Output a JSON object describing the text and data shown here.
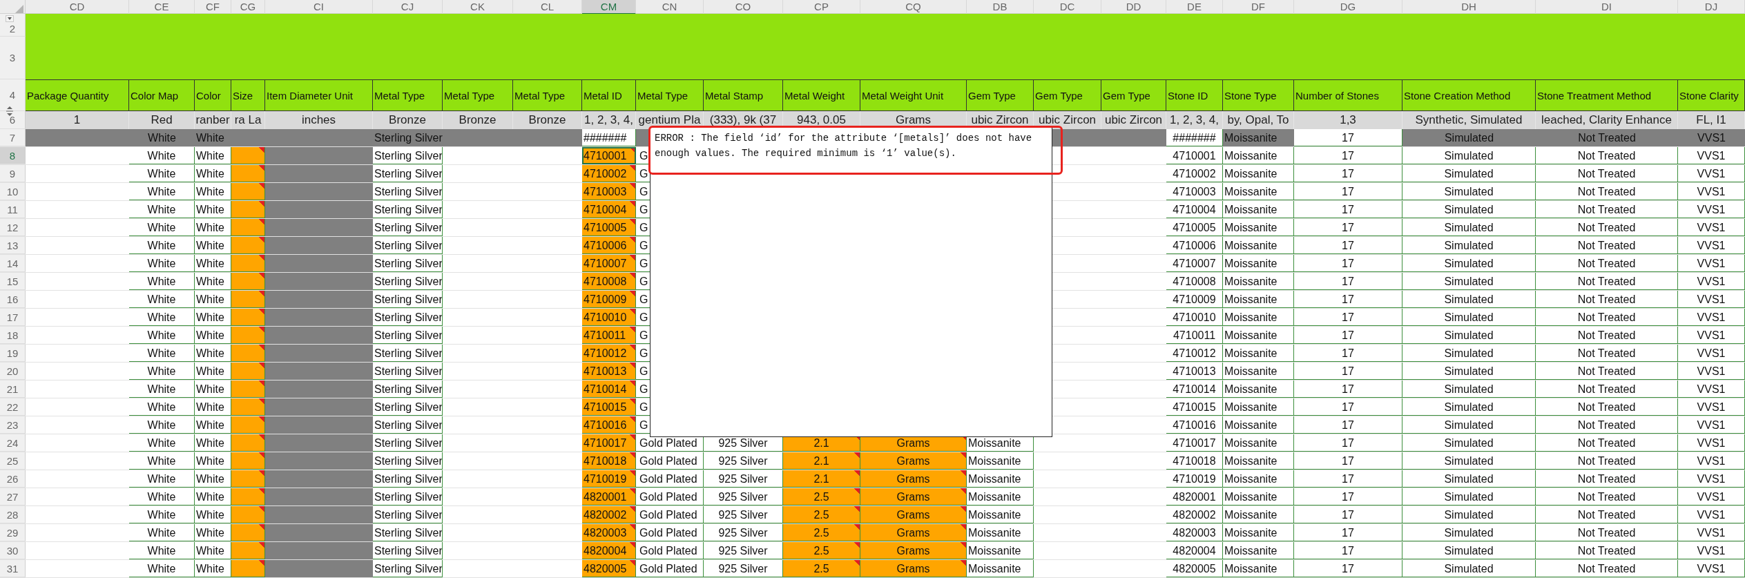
{
  "sheet": {
    "columns": [
      {
        "letter": "CD",
        "header": "Package Quantity",
        "example": "1",
        "kind": "plain",
        "selected": false
      },
      {
        "letter": "CE",
        "header": "Color Map",
        "example": "Red",
        "kind": "bordered",
        "selected": false
      },
      {
        "letter": "CF",
        "header": "Color",
        "example": "ranber",
        "kind": "bordered",
        "selected": false
      },
      {
        "letter": "CG",
        "header": "Size",
        "example": "ra La",
        "kind": "bordered",
        "selected": false
      },
      {
        "letter": "CI",
        "header": "Item Diameter Unit",
        "example": "inches",
        "kind": "plain",
        "selected": false
      },
      {
        "letter": "CJ",
        "header": "Metal Type",
        "example": "Bronze",
        "kind": "bordered",
        "selected": false
      },
      {
        "letter": "CK",
        "header": "Metal Type",
        "example": "Bronze",
        "kind": "plain",
        "selected": false
      },
      {
        "letter": "CL",
        "header": "Metal Type",
        "example": "Bronze",
        "kind": "plain",
        "selected": false
      },
      {
        "letter": "CM",
        "header": "Metal ID",
        "example": "1, 2, 3, 4,",
        "kind": "bordered",
        "selected": true
      },
      {
        "letter": "CN",
        "header": "Metal Type",
        "example": "gentium Pla",
        "kind": "bordered",
        "selected": false
      },
      {
        "letter": "CO",
        "header": "Metal Stamp",
        "example": "(333), 9k (37",
        "kind": "bordered",
        "selected": false
      },
      {
        "letter": "CP",
        "header": "Metal Weight",
        "example": "943, 0.05",
        "kind": "bordered",
        "selected": false
      },
      {
        "letter": "CQ",
        "header": "Metal Weight Unit",
        "example": "Grams",
        "kind": "bordered",
        "selected": false
      },
      {
        "letter": "DB",
        "header": "Gem Type",
        "example": "ubic Zircon",
        "kind": "bordered",
        "selected": false
      },
      {
        "letter": "DC",
        "header": "Gem Type",
        "example": "ubic Zircon",
        "kind": "plain",
        "selected": false
      },
      {
        "letter": "DD",
        "header": "Gem Type",
        "example": "ubic Zircon",
        "kind": "plain",
        "selected": false
      },
      {
        "letter": "DE",
        "header": "Stone ID",
        "example": "1, 2, 3, 4,",
        "kind": "bordered",
        "selected": false
      },
      {
        "letter": "DF",
        "header": "Stone Type",
        "example": "by, Opal, To",
        "kind": "bordered",
        "selected": false
      },
      {
        "letter": "DG",
        "header": "Number of Stones",
        "example": "1,3",
        "kind": "bordered",
        "selected": false
      },
      {
        "letter": "DH",
        "header": "Stone Creation Method",
        "example": "Synthetic, Simulated",
        "kind": "bordered",
        "selected": false
      },
      {
        "letter": "DI",
        "header": "Stone Treatment Method",
        "example": "leached, Clarity Enhance",
        "kind": "bordered",
        "selected": false
      },
      {
        "letter": "DJ",
        "header": "Stone Clarity",
        "example": "FL, I1",
        "kind": "bordered",
        "selected": false
      }
    ],
    "banner_rows": [
      "2",
      "3"
    ],
    "header_row_number": "4",
    "example_row_number": "6",
    "rows": [
      {
        "number": "7",
        "selected": false,
        "cells": [
          {
            "kind": "shaded"
          },
          {
            "text": "White",
            "kind": "shaded"
          },
          {
            "text": "White",
            "kind": "shaded"
          },
          {
            "kind": "shaded"
          },
          {
            "kind": "shaded"
          },
          {
            "text": "Sterling Silver",
            "kind": "shaded"
          },
          {
            "kind": "shaded"
          },
          {
            "kind": "shaded"
          },
          "#######",
          {
            "kind": "shaded"
          },
          null,
          null,
          null,
          null,
          {
            "kind": "shaded"
          },
          {
            "kind": "shaded"
          },
          "#######",
          {
            "text": "Moissanite",
            "kind": "shaded"
          },
          "17",
          {
            "text": "Simulated",
            "kind": "shaded"
          },
          {
            "text": "Not Treated",
            "kind": "shaded"
          },
          {
            "text": "VVS1",
            "kind": "shaded"
          }
        ]
      },
      {
        "number": "8",
        "selected": true,
        "cells": [
          null,
          "White",
          "White",
          {
            "kind": "flagged"
          },
          {
            "kind": "shaded"
          },
          "Sterling Silver",
          null,
          null,
          {
            "text": "4710001",
            "kind": "flagged"
          },
          "G",
          null,
          null,
          null,
          null,
          null,
          null,
          "4710001",
          "Moissanite",
          "17",
          "Simulated",
          "Not Treated",
          "VVS1"
        ]
      },
      {
        "number": "9",
        "selected": false,
        "cells": [
          null,
          "White",
          "White",
          {
            "kind": "flagged"
          },
          {
            "kind": "shaded"
          },
          "Sterling Silver",
          null,
          null,
          {
            "text": "4710002",
            "kind": "flagged"
          },
          "G",
          null,
          null,
          null,
          null,
          null,
          null,
          "4710002",
          "Moissanite",
          "17",
          "Simulated",
          "Not Treated",
          "VVS1"
        ]
      },
      {
        "number": "10",
        "selected": false,
        "cells": [
          null,
          "White",
          "White",
          {
            "kind": "flagged"
          },
          {
            "kind": "shaded"
          },
          "Sterling Silver",
          null,
          null,
          {
            "text": "4710003",
            "kind": "flagged"
          },
          "G",
          null,
          null,
          null,
          null,
          null,
          null,
          "4710003",
          "Moissanite",
          "17",
          "Simulated",
          "Not Treated",
          "VVS1"
        ]
      },
      {
        "number": "11",
        "selected": false,
        "cells": [
          null,
          "White",
          "White",
          {
            "kind": "flagged"
          },
          {
            "kind": "shaded"
          },
          "Sterling Silver",
          null,
          null,
          {
            "text": "4710004",
            "kind": "flagged"
          },
          "G",
          null,
          null,
          null,
          null,
          null,
          null,
          "4710004",
          "Moissanite",
          "17",
          "Simulated",
          "Not Treated",
          "VVS1"
        ]
      },
      {
        "number": "12",
        "selected": false,
        "cells": [
          null,
          "White",
          "White",
          {
            "kind": "flagged"
          },
          {
            "kind": "shaded"
          },
          "Sterling Silver",
          null,
          null,
          {
            "text": "4710005",
            "kind": "flagged"
          },
          "G",
          null,
          null,
          null,
          null,
          null,
          null,
          "4710005",
          "Moissanite",
          "17",
          "Simulated",
          "Not Treated",
          "VVS1"
        ]
      },
      {
        "number": "13",
        "selected": false,
        "cells": [
          null,
          "White",
          "White",
          {
            "kind": "flagged"
          },
          {
            "kind": "shaded"
          },
          "Sterling Silver",
          null,
          null,
          {
            "text": "4710006",
            "kind": "flagged"
          },
          "G",
          null,
          null,
          null,
          null,
          null,
          null,
          "4710006",
          "Moissanite",
          "17",
          "Simulated",
          "Not Treated",
          "VVS1"
        ]
      },
      {
        "number": "14",
        "selected": false,
        "cells": [
          null,
          "White",
          "White",
          {
            "kind": "flagged"
          },
          {
            "kind": "shaded"
          },
          "Sterling Silver",
          null,
          null,
          {
            "text": "4710007",
            "kind": "flagged"
          },
          "G",
          null,
          null,
          null,
          null,
          null,
          null,
          "4710007",
          "Moissanite",
          "17",
          "Simulated",
          "Not Treated",
          "VVS1"
        ]
      },
      {
        "number": "15",
        "selected": false,
        "cells": [
          null,
          "White",
          "White",
          {
            "kind": "flagged"
          },
          {
            "kind": "shaded"
          },
          "Sterling Silver",
          null,
          null,
          {
            "text": "4710008",
            "kind": "flagged"
          },
          "G",
          null,
          null,
          null,
          null,
          null,
          null,
          "4710008",
          "Moissanite",
          "17",
          "Simulated",
          "Not Treated",
          "VVS1"
        ]
      },
      {
        "number": "16",
        "selected": false,
        "cells": [
          null,
          "White",
          "White",
          {
            "kind": "flagged"
          },
          {
            "kind": "shaded"
          },
          "Sterling Silver",
          null,
          null,
          {
            "text": "4710009",
            "kind": "flagged"
          },
          "G",
          null,
          null,
          null,
          null,
          null,
          null,
          "4710009",
          "Moissanite",
          "17",
          "Simulated",
          "Not Treated",
          "VVS1"
        ]
      },
      {
        "number": "17",
        "selected": false,
        "cells": [
          null,
          "White",
          "White",
          {
            "kind": "flagged"
          },
          {
            "kind": "shaded"
          },
          "Sterling Silver",
          null,
          null,
          {
            "text": "4710010",
            "kind": "flagged"
          },
          "G",
          null,
          null,
          null,
          null,
          null,
          null,
          "4710010",
          "Moissanite",
          "17",
          "Simulated",
          "Not Treated",
          "VVS1"
        ]
      },
      {
        "number": "18",
        "selected": false,
        "cells": [
          null,
          "White",
          "White",
          {
            "kind": "flagged"
          },
          {
            "kind": "shaded"
          },
          "Sterling Silver",
          null,
          null,
          {
            "text": "4710011",
            "kind": "flagged"
          },
          "G",
          null,
          null,
          null,
          null,
          null,
          null,
          "4710011",
          "Moissanite",
          "17",
          "Simulated",
          "Not Treated",
          "VVS1"
        ]
      },
      {
        "number": "19",
        "selected": false,
        "cells": [
          null,
          "White",
          "White",
          {
            "kind": "flagged"
          },
          {
            "kind": "shaded"
          },
          "Sterling Silver",
          null,
          null,
          {
            "text": "4710012",
            "kind": "flagged"
          },
          "G",
          null,
          null,
          null,
          null,
          null,
          null,
          "4710012",
          "Moissanite",
          "17",
          "Simulated",
          "Not Treated",
          "VVS1"
        ]
      },
      {
        "number": "20",
        "selected": false,
        "cells": [
          null,
          "White",
          "White",
          {
            "kind": "flagged"
          },
          {
            "kind": "shaded"
          },
          "Sterling Silver",
          null,
          null,
          {
            "text": "4710013",
            "kind": "flagged"
          },
          "G",
          null,
          null,
          null,
          null,
          null,
          null,
          "4710013",
          "Moissanite",
          "17",
          "Simulated",
          "Not Treated",
          "VVS1"
        ]
      },
      {
        "number": "21",
        "selected": false,
        "cells": [
          null,
          "White",
          "White",
          {
            "kind": "flagged"
          },
          {
            "kind": "shaded"
          },
          "Sterling Silver",
          null,
          null,
          {
            "text": "4710014",
            "kind": "flagged"
          },
          "G",
          null,
          null,
          null,
          null,
          null,
          null,
          "4710014",
          "Moissanite",
          "17",
          "Simulated",
          "Not Treated",
          "VVS1"
        ]
      },
      {
        "number": "22",
        "selected": false,
        "cells": [
          null,
          "White",
          "White",
          {
            "kind": "flagged"
          },
          {
            "kind": "shaded"
          },
          "Sterling Silver",
          null,
          null,
          {
            "text": "4710015",
            "kind": "flagged"
          },
          "G",
          null,
          null,
          null,
          null,
          null,
          null,
          "4710015",
          "Moissanite",
          "17",
          "Simulated",
          "Not Treated",
          "VVS1"
        ]
      },
      {
        "number": "23",
        "selected": false,
        "cells": [
          null,
          "White",
          "White",
          {
            "kind": "flagged"
          },
          {
            "kind": "shaded"
          },
          "Sterling Silver",
          null,
          null,
          {
            "text": "4710016",
            "kind": "flagged"
          },
          "G",
          null,
          null,
          null,
          null,
          null,
          null,
          "4710016",
          "Moissanite",
          "17",
          "Simulated",
          "Not Treated",
          "VVS1"
        ]
      },
      {
        "number": "24",
        "selected": false,
        "cells": [
          null,
          "White",
          "White",
          {
            "kind": "flagged"
          },
          {
            "kind": "shaded"
          },
          "Sterling Silver",
          null,
          null,
          {
            "text": "4710017",
            "kind": "flagged"
          },
          "Gold Plated",
          "925 Silver",
          {
            "text": "2.1",
            "kind": "flagged"
          },
          {
            "text": "Grams",
            "kind": "flagged"
          },
          "Moissanite",
          null,
          null,
          "4710017",
          "Moissanite",
          "17",
          "Simulated",
          "Not Treated",
          "VVS1"
        ]
      },
      {
        "number": "25",
        "selected": false,
        "cells": [
          null,
          "White",
          "White",
          {
            "kind": "flagged"
          },
          {
            "kind": "shaded"
          },
          "Sterling Silver",
          null,
          null,
          {
            "text": "4710018",
            "kind": "flagged"
          },
          "Gold Plated",
          "925 Silver",
          {
            "text": "2.1",
            "kind": "flagged"
          },
          {
            "text": "Grams",
            "kind": "flagged"
          },
          "Moissanite",
          null,
          null,
          "4710018",
          "Moissanite",
          "17",
          "Simulated",
          "Not Treated",
          "VVS1"
        ]
      },
      {
        "number": "26",
        "selected": false,
        "cells": [
          null,
          "White",
          "White",
          {
            "kind": "flagged"
          },
          {
            "kind": "shaded"
          },
          "Sterling Silver",
          null,
          null,
          {
            "text": "4710019",
            "kind": "flagged"
          },
          "Gold Plated",
          "925 Silver",
          {
            "text": "2.1",
            "kind": "flagged"
          },
          {
            "text": "Grams",
            "kind": "flagged"
          },
          "Moissanite",
          null,
          null,
          "4710019",
          "Moissanite",
          "17",
          "Simulated",
          "Not Treated",
          "VVS1"
        ]
      },
      {
        "number": "27",
        "selected": false,
        "cells": [
          null,
          "White",
          "White",
          {
            "kind": "flagged"
          },
          {
            "kind": "shaded"
          },
          "Sterling Silver",
          null,
          null,
          {
            "text": "4820001",
            "kind": "flagged"
          },
          "Gold Plated",
          "925 Silver",
          {
            "text": "2.5",
            "kind": "flagged"
          },
          {
            "text": "Grams",
            "kind": "flagged"
          },
          "Moissanite",
          null,
          null,
          "4820001",
          "Moissanite",
          "17",
          "Simulated",
          "Not Treated",
          "VVS1"
        ]
      },
      {
        "number": "28",
        "selected": false,
        "cells": [
          null,
          "White",
          "White",
          {
            "kind": "flagged"
          },
          {
            "kind": "shaded"
          },
          "Sterling Silver",
          null,
          null,
          {
            "text": "4820002",
            "kind": "flagged"
          },
          "Gold Plated",
          "925 Silver",
          {
            "text": "2.5",
            "kind": "flagged"
          },
          {
            "text": "Grams",
            "kind": "flagged"
          },
          "Moissanite",
          null,
          null,
          "4820002",
          "Moissanite",
          "17",
          "Simulated",
          "Not Treated",
          "VVS1"
        ]
      },
      {
        "number": "29",
        "selected": false,
        "cells": [
          null,
          "White",
          "White",
          {
            "kind": "flagged"
          },
          {
            "kind": "shaded"
          },
          "Sterling Silver",
          null,
          null,
          {
            "text": "4820003",
            "kind": "flagged"
          },
          "Gold Plated",
          "925 Silver",
          {
            "text": "2.5",
            "kind": "flagged"
          },
          {
            "text": "Grams",
            "kind": "flagged"
          },
          "Moissanite",
          null,
          null,
          "4820003",
          "Moissanite",
          "17",
          "Simulated",
          "Not Treated",
          "VVS1"
        ]
      },
      {
        "number": "30",
        "selected": false,
        "cells": [
          null,
          "White",
          "White",
          {
            "kind": "flagged"
          },
          {
            "kind": "shaded"
          },
          "Sterling Silver",
          null,
          null,
          {
            "text": "4820004",
            "kind": "flagged"
          },
          "Gold Plated",
          "925 Silver",
          {
            "text": "2.5",
            "kind": "flagged"
          },
          {
            "text": "Grams",
            "kind": "flagged"
          },
          "Moissanite",
          null,
          null,
          "4820004",
          "Moissanite",
          "17",
          "Simulated",
          "Not Treated",
          "VVS1"
        ]
      },
      {
        "number": "31",
        "selected": false,
        "cells": [
          null,
          "White",
          "White",
          {
            "kind": "flagged"
          },
          {
            "kind": "shaded"
          },
          "Sterling Silver",
          null,
          null,
          {
            "text": "4820005",
            "kind": "flagged"
          },
          "Gold Plated",
          "925 Silver",
          {
            "text": "2.5",
            "kind": "flagged"
          },
          {
            "text": "Grams",
            "kind": "flagged"
          },
          "Moissanite",
          null,
          null,
          "4820005",
          "Moissanite",
          "17",
          "Simulated",
          "Not Treated",
          "VVS1"
        ]
      }
    ]
  },
  "comment": {
    "text": "ERROR : The field ‘id’ for the attribute ‘[metals]’ does not have enough values. The required minimum is ‘1’ value(s)."
  }
}
